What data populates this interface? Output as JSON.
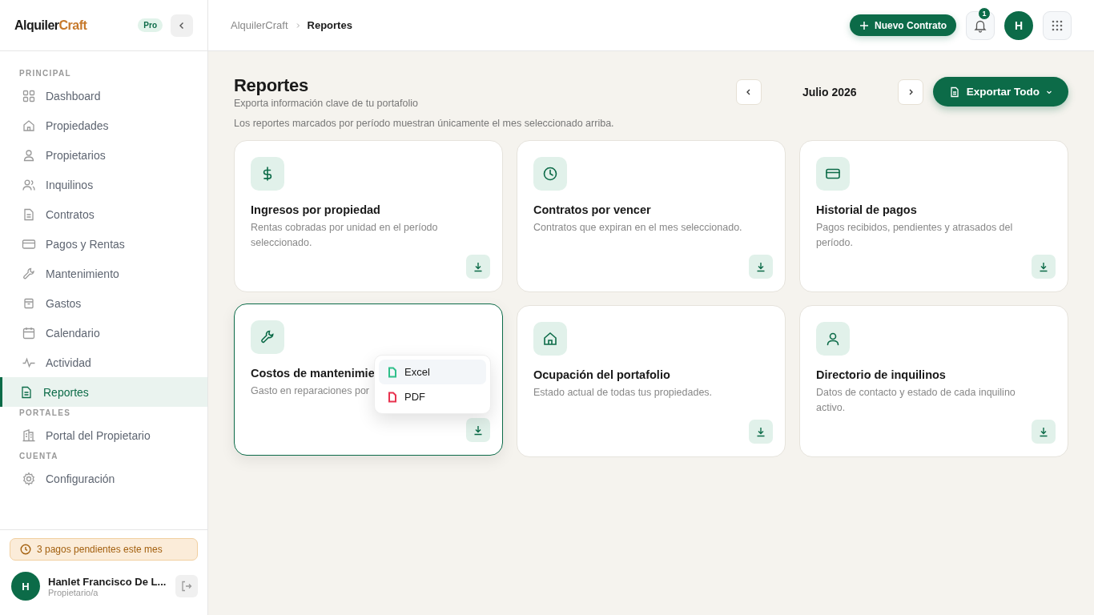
{
  "sidebar": {
    "brand": {
      "part_1": "Alquiler",
      "part_2": "Craft"
    },
    "badge": "Pro",
    "sections": [
      {
        "title": "PRINCIPAL",
        "items": [
          {
            "label": "Dashboard",
            "selected": false
          },
          {
            "label": "Propiedades",
            "selected": false
          },
          {
            "label": "Propietarios",
            "selected": false
          },
          {
            "label": "Inquilinos",
            "selected": false
          },
          {
            "label": "Contratos",
            "selected": false
          },
          {
            "label": "Pagos y Rentas",
            "selected": false
          },
          {
            "label": "Mantenimiento",
            "selected": false
          },
          {
            "label": "Gastos",
            "selected": false
          },
          {
            "label": "Calendario",
            "selected": false
          },
          {
            "label": "Actividad",
            "selected": false
          },
          {
            "label": "Reportes",
            "selected": true
          }
        ]
      },
      {
        "title": "PORTALES",
        "items": [
          {
            "label": "Portal del Propietario",
            "selected": false
          }
        ]
      },
      {
        "title": "CUENTA",
        "items": [
          {
            "label": "Configuración",
            "selected": false
          }
        ]
      }
    ],
    "alert": "3 pagos pendientes este mes",
    "user": {
      "initial": "H",
      "name": "Hanlet Francisco De L...",
      "role": "Propietario/a"
    }
  },
  "topbar": {
    "breadcrumb": [
      "AlquilerCraft",
      "Reportes"
    ],
    "new_button": "Nuevo Contrato",
    "notifications": "1",
    "avatar": "H"
  },
  "page": {
    "title": "Reportes",
    "subtitle": "Exporta información clave de tu portafolio",
    "note": "Los reportes marcados por período muestran únicamente el mes seleccionado arriba.",
    "month": "Julio 2026",
    "export_button": "Exportar Todo"
  },
  "cards": [
    {
      "title": "Ingresos por propiedad",
      "description": "Rentas cobradas por unidad en el período seleccionado.",
      "open": false
    },
    {
      "title": "Contratos por vencer",
      "description": "Contratos que expiran en el mes seleccionado.",
      "open": false
    },
    {
      "title": "Historial de pagos",
      "description": "Pagos recibidos, pendientes y atrasados del período.",
      "open": false
    },
    {
      "title": "Costos de mantenimie",
      "description": "Gasto en reparaciones por",
      "open": true
    },
    {
      "title": "Ocupación del portafolio",
      "description": "Estado actual de todas tus propiedades.",
      "open": false
    },
    {
      "title": "Directorio de inquilinos",
      "description": "Datos de contacto y estado de cada inquilino activo.",
      "open": false
    }
  ],
  "export_menu": [
    {
      "label": "Excel",
      "selected": true,
      "color": "#2fbf8a"
    },
    {
      "label": "PDF",
      "selected": false,
      "color": "#e8334f"
    }
  ]
}
